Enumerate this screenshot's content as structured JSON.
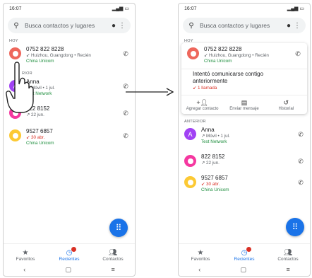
{
  "status": {
    "time": "16:07"
  },
  "search": {
    "placeholder": "Busca contactos y lugares"
  },
  "sections": {
    "today": "HOY",
    "earlier": "ANTERIOR",
    "earlier_partial": "RIOR"
  },
  "calls": [
    {
      "name": "0752 822 8228",
      "detail": "↙ Huizhou, Guangdong • Recién",
      "network": "China Unicom"
    },
    {
      "name": "Anna",
      "detail": "↗ Móvil • 1 jul.",
      "network": "Test Network"
    },
    {
      "name": "822 8152",
      "detail": "↗ 22 jun.",
      "network": ""
    },
    {
      "name": "9527 6857",
      "detail": "30 abr.",
      "network": "China Unicom"
    }
  ],
  "expanded": {
    "message": "Intentó comunicarse contigo anteriormente",
    "missed": "1 llamada",
    "actions": [
      "Agregar contacto",
      "Enviar mensaje",
      "Historial"
    ]
  },
  "nav": {
    "favorites": "Favoritos",
    "recents": "Recientes",
    "contacts": "Contactos"
  },
  "avatar_letter": "A",
  "icons": [
    "search-icon",
    "mic-icon",
    "more-icon",
    "phone-icon",
    "dialpad-icon",
    "star-icon",
    "clock-icon",
    "people-icon",
    "back-icon",
    "home-icon",
    "menu-icon",
    "add-contact-icon",
    "message-icon",
    "history-icon",
    "pointing-hand-icon",
    "arrow-icon"
  ],
  "colors": {
    "accent": "#1a73e8",
    "network": "#1e8e3e",
    "missed": "#d93025"
  }
}
